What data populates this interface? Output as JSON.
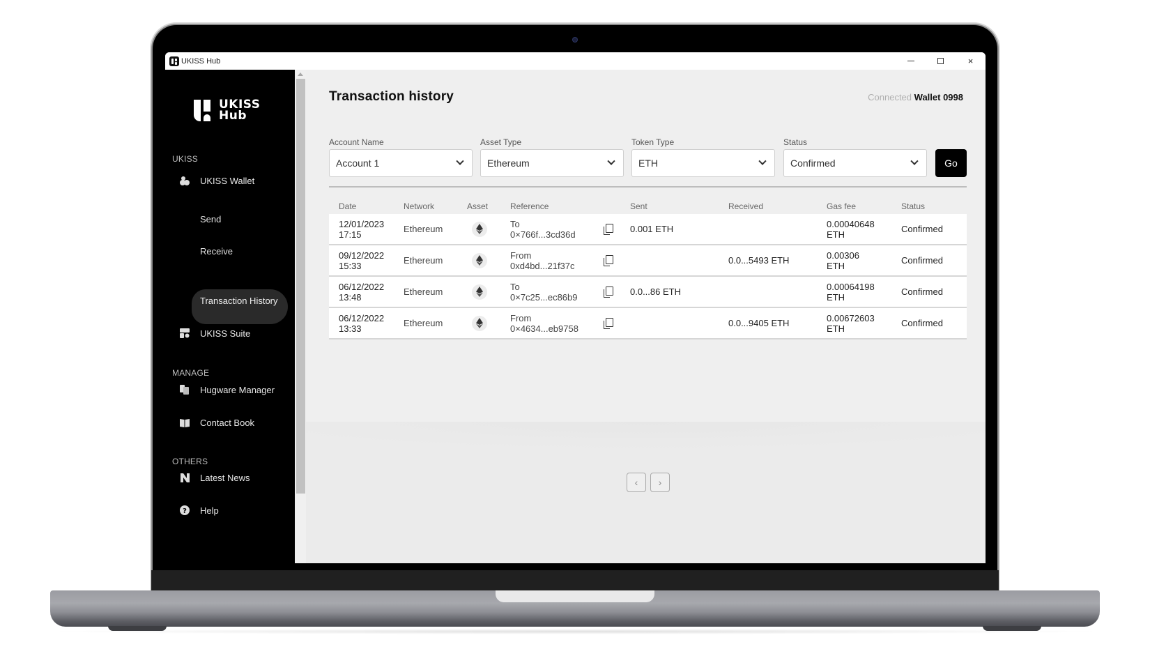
{
  "window": {
    "title": "UKISS Hub",
    "controls": {
      "minimize": "minimize",
      "maximize": "maximize",
      "close": "×"
    }
  },
  "sidebar": {
    "logo": {
      "line1": "UKISS",
      "line2": "Hub"
    },
    "sections": {
      "ukiss": "UKISS",
      "manage": "MANAGE",
      "others": "OTHERS"
    },
    "items": {
      "wallet": "UKISS Wallet",
      "send": "Send",
      "receive": "Receive",
      "transaction_history": "Transaction History",
      "suite": "UKISS Suite",
      "hugware": "Hugware Manager",
      "contacts": "Contact Book",
      "news": "Latest News",
      "help": "Help"
    },
    "active_item": "Transaction History"
  },
  "main": {
    "title": "Transaction history",
    "connected_label": "Connected",
    "wallet_name": "Wallet 0998",
    "filters": [
      {
        "label": "Account Name",
        "value": "Account 1"
      },
      {
        "label": "Asset Type",
        "value": "Ethereum"
      },
      {
        "label": "Token Type",
        "value": "ETH"
      },
      {
        "label": "Status",
        "value": "Confirmed"
      }
    ],
    "go_label": "Go",
    "table": {
      "headers": [
        "Date",
        "Network",
        "Asset",
        "Reference",
        "Sent",
        "Received",
        "Gas fee",
        "Status"
      ],
      "rows": [
        {
          "date": "12/01/2023",
          "time": "17:15",
          "network": "Ethereum",
          "asset_icon": "ethereum-icon",
          "direction": "To",
          "address": "0×766f...3cd36d",
          "sent": "0.001 ETH",
          "received": "",
          "gas_amount": "0.00040648",
          "gas_unit": "ETH",
          "status": "Confirmed"
        },
        {
          "date": "09/12/2022",
          "time": "15:33",
          "network": "Ethereum",
          "asset_icon": "ethereum-icon",
          "direction": "From",
          "address": "0xd4bd...21f37c",
          "sent": "",
          "received": "0.0...5493 ETH",
          "gas_amount": "0.00306",
          "gas_unit": "ETH",
          "status": "Confirmed"
        },
        {
          "date": "06/12/2022",
          "time": "13:48",
          "network": "Ethereum",
          "asset_icon": "ethereum-icon",
          "direction": "To",
          "address": "0×7c25...ec86b9",
          "sent": "0.0...86 ETH",
          "received": "",
          "gas_amount": "0.00064198",
          "gas_unit": "ETH",
          "status": "Confirmed"
        },
        {
          "date": "06/12/2022",
          "time": "13:33",
          "network": "Ethereum",
          "asset_icon": "ethereum-icon",
          "direction": "From",
          "address": "0×4634...eb9758",
          "sent": "",
          "received": "0.0...9405 ETH",
          "gas_amount": "0.00672603",
          "gas_unit": "ETH",
          "status": "Confirmed"
        }
      ]
    },
    "pagination": {
      "prev": "‹",
      "next": "›"
    }
  },
  "colors": {
    "sidebar_bg": "#000000",
    "active_item_bg": "#2a2a2a",
    "content_bg": "#efefef",
    "primary_button": "#000000"
  }
}
